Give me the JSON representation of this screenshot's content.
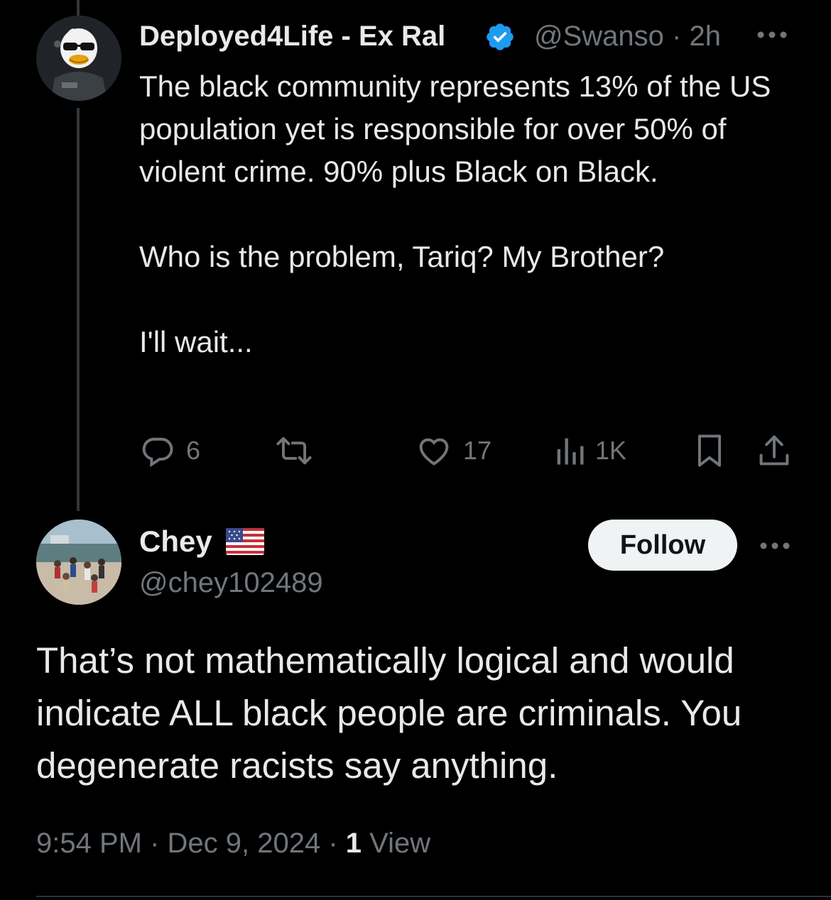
{
  "parent_tweet": {
    "display_name": "Deployed4Life - Ex Ral",
    "handle": "@Swanso",
    "separator": "·",
    "time": "2h",
    "paragraphs": [
      "The black community represents 13% of the US population yet is responsible for over 50% of violent crime. 90% plus Black on Black.",
      "Who is the problem, Tariq? My Brother?",
      "I'll wait..."
    ],
    "counts": {
      "replies": "6",
      "likes": "17",
      "views": "1K"
    }
  },
  "reply": {
    "display_name": "Chey",
    "handle": "@chey102489",
    "follow_label": "Follow",
    "text": "That’s not mathematically logical and would indicate ALL black people are criminals. You degenerate racists say anything.",
    "time": "9:54 PM",
    "date": "Dec 9, 2024",
    "views_count": "1",
    "views_label": "View"
  },
  "colors": {
    "background": "#000000",
    "text_primary": "#e7e9ea",
    "text_secondary": "#71767b",
    "verified_blue": "#1d9bf0",
    "follow_button_bg": "#eff3f4"
  },
  "icons": [
    "reply-icon",
    "repost-icon",
    "like-icon",
    "views-icon",
    "bookmark-icon",
    "share-icon",
    "more-icon",
    "verified-badge-icon",
    "us-flag-icon"
  ]
}
